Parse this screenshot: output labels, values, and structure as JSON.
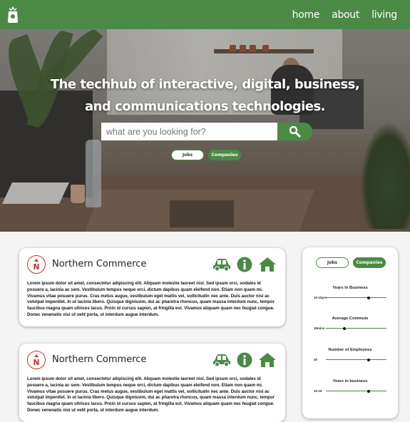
{
  "nav": {
    "items": [
      "home",
      "about",
      "living"
    ]
  },
  "hero": {
    "title_line1": "The techhub of interactive, digital, business,",
    "title_line2": "and communications technologies.",
    "search_placeholder": "what are you looking for?",
    "toggle_jobs": "Jobs",
    "toggle_companies": "Companies"
  },
  "cards": [
    {
      "name": "Northern Commerce",
      "description": "Lorem ipsum dolor sit amet, consectetur adipiscing elit. Aliquam molestie laoreet nisl. Sed ipsum orci, sodales id posuere a, lacinia ac sem. Vestibulum tempus neque orci, dictum dapibus quam eleifend non. Etiam non quam mi. Vivamus vitae posuere purus. Cras metus augue, vestibulum eget mattis vel, sollicitudin nec ante. Duis auctor nisi ac volutpat imperdiet. In ut lacinia libero. Quisque dignissim, dui ac pharetra rhoncus, quam massa interdum nunc, tempor faucibus magna quam ultrices lacus. Proin id cursus sapien, at fringilla est. Vivamus aliquam quam nec feugiat congue. Donec venenatis nisi ut velit porta, ut interdum augue interdum."
    },
    {
      "name": "Northern Commerce",
      "description": "Lorem ipsum dolor sit amet, consectetur adipiscing elit. Aliquam molestie laoreet nisl. Sed ipsum orci, sodales id posuere a, lacinia ac sem. Vestibulum tempus neque orci, dictum dapibus quam eleifend non. Etiam non quam mi. Vivamus vitae posuere purus. Cras metus augue, vestibulum eget mattis vel, sollicitudin nec ante. Duis auctor nisi ac volutpat imperdiet. In ut lacinia libero. Quisque dignissim, dui ac pharetra rhoncus, quam massa interdum nunc, tempor faucibus magna quam ultrices lacus. Proin id cursus sapien, at fringilla est. Vivamus aliquam quam nec feugiat congue. Donec venenatis nisi ut velit porta, ut interdum augue interdum."
    }
  ],
  "filter": {
    "toggle_jobs": "Jobs",
    "toggle_companies": "Companies",
    "sliders": [
      {
        "label": "Years In Business",
        "value": "10-15yrs",
        "fraction": 0.7
      },
      {
        "label": "Average Commute",
        "value": "20mins",
        "fraction": 0.3
      },
      {
        "label": "Number of Employees",
        "value": "30",
        "fraction": 0.7
      },
      {
        "label": "Years in business",
        "value": "10-15",
        "fraction": 0.7
      }
    ]
  },
  "colors": {
    "brand_green": "#4a8a45",
    "brand_red": "#c0352f"
  },
  "icons": [
    "logo-icon",
    "search-icon",
    "car-icon",
    "info-icon",
    "home-icon"
  ]
}
